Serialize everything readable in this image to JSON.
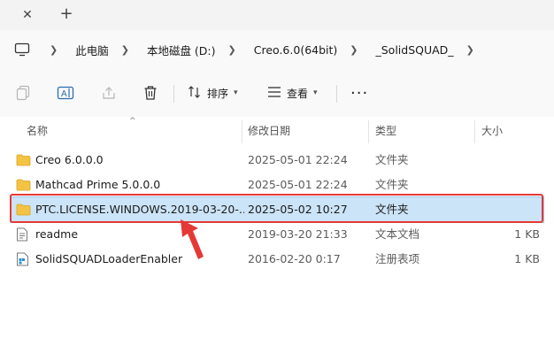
{
  "tabbar": {
    "close_icon": "close-icon",
    "new_tab_icon": "plus-icon"
  },
  "breadcrumb": {
    "root_icon": "computer-icon",
    "items": [
      "此电脑",
      "本地磁盘 (D:)",
      "Creo.6.0(64bit)",
      "_SolidSQUAD_"
    ]
  },
  "toolbar": {
    "copy_icon": "copy-icon",
    "rename_icon": "rename-icon",
    "share_icon": "share-icon",
    "delete_icon": "trash-icon",
    "sort_label": "排序",
    "view_label": "查看",
    "more_icon": "more-icon"
  },
  "columns": {
    "name": "名称",
    "date": "修改日期",
    "type": "类型",
    "size": "大小"
  },
  "files": [
    {
      "icon": "folder-icon",
      "name": "Creo 6.0.0.0",
      "date": "2025-05-01 22:24",
      "type": "文件夹",
      "size": ""
    },
    {
      "icon": "folder-icon",
      "name": "Mathcad Prime 5.0.0.0",
      "date": "2025-05-01 22:24",
      "type": "文件夹",
      "size": ""
    },
    {
      "icon": "folder-icon",
      "name": "PTC.LICENSE.WINDOWS.2019-03-20-...",
      "date": "2025-05-02 10:27",
      "type": "文件夹",
      "size": "",
      "selected": true
    },
    {
      "icon": "text-file-icon",
      "name": "readme",
      "date": "2019-03-20 21:33",
      "type": "文本文档",
      "size": "1 KB"
    },
    {
      "icon": "registry-file-icon",
      "name": "SolidSQUADLoaderEnabler",
      "date": "2016-02-20 0:17",
      "type": "注册表项",
      "size": "1 KB"
    }
  ],
  "colors": {
    "selection": "#cce4f7",
    "annotation": "#e53935",
    "folder": "#f5c343"
  }
}
